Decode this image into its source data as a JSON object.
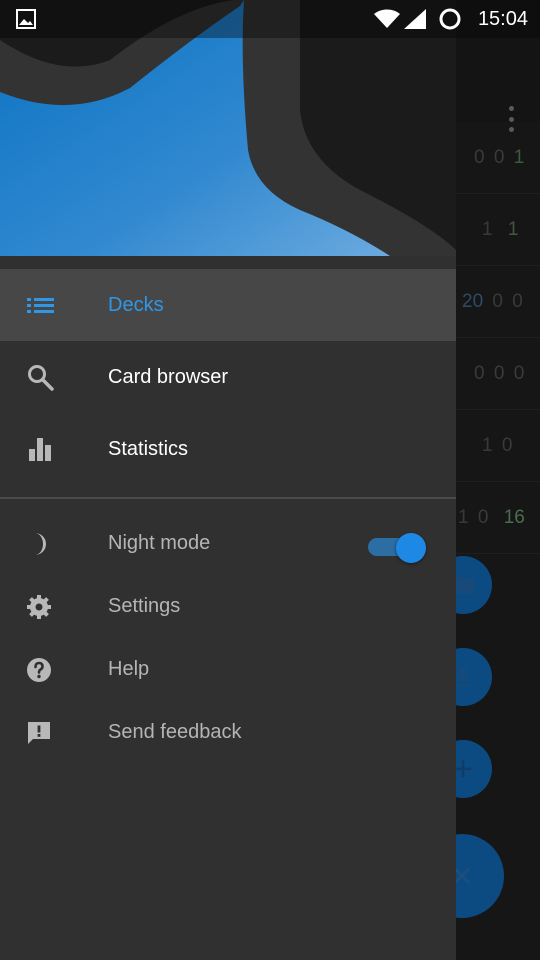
{
  "status_bar": {
    "time": "15:04",
    "icons": [
      "gallery-icon",
      "wifi-icon",
      "signal-icon",
      "sync-icon"
    ]
  },
  "drawer": {
    "main_items": [
      {
        "label": "Decks",
        "icon": "list-icon",
        "selected": true
      },
      {
        "label": "Card browser",
        "icon": "search-icon",
        "selected": false
      },
      {
        "label": "Statistics",
        "icon": "bar-chart-icon",
        "selected": false
      }
    ],
    "secondary_items": [
      {
        "label": "Night mode",
        "icon": "moon-icon",
        "toggle": true
      },
      {
        "label": "Settings",
        "icon": "gear-icon"
      },
      {
        "label": "Help",
        "icon": "help-icon"
      },
      {
        "label": "Send feedback",
        "icon": "feedback-icon"
      }
    ]
  },
  "background": {
    "deck_rows": [
      {
        "new": "0",
        "learn": "0",
        "review": "1"
      },
      {
        "new": "",
        "learn": "1",
        "review": "1"
      },
      {
        "new": "20",
        "learn": "0",
        "review": "0"
      },
      {
        "new": "0",
        "learn": "0",
        "review": "0"
      },
      {
        "new": "",
        "learn": "1",
        "review": "0"
      },
      {
        "new": "1",
        "learn": "0",
        "review": "16"
      }
    ]
  },
  "colors": {
    "accent": "#2f97e8",
    "drawer_bg": "#303030",
    "selected_bg": "#474747",
    "header_blue": "#2a7ec6"
  }
}
